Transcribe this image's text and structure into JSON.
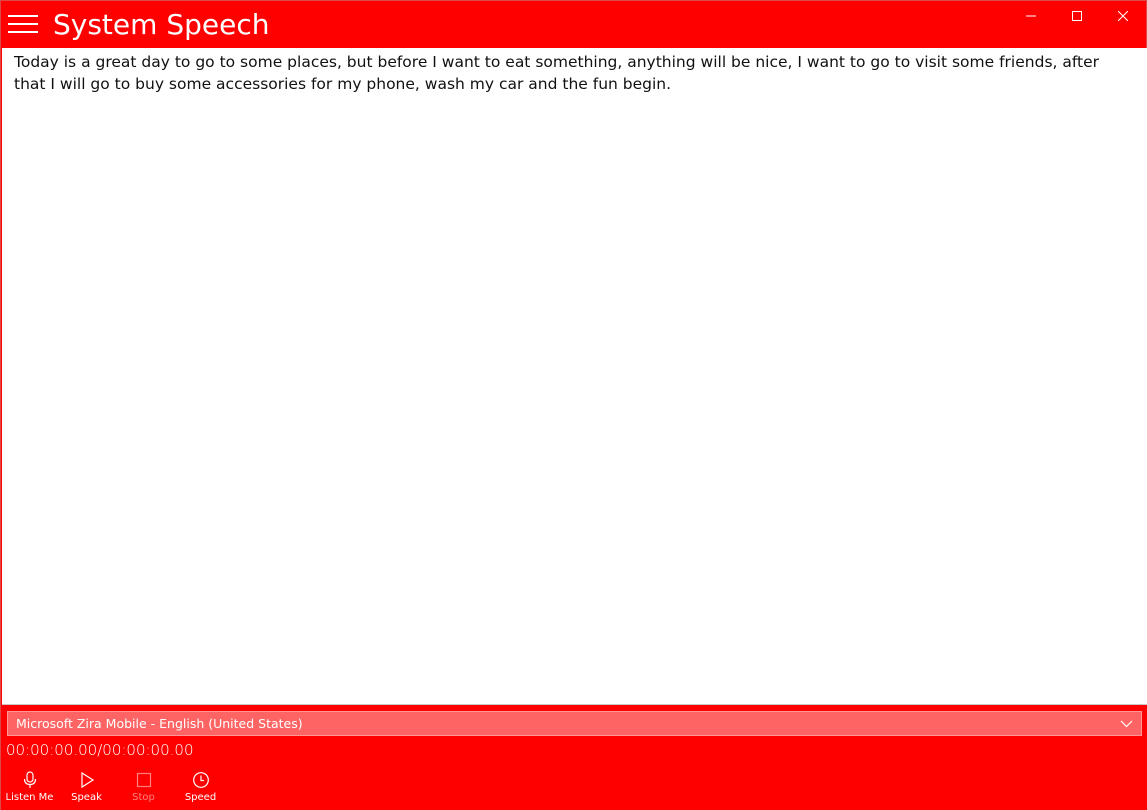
{
  "window": {
    "title": "System Speech",
    "accent_color": "#ff0000"
  },
  "editor": {
    "text": "Today is a great day to go to some places, but before I want to eat something, anything will be nice, I want to go to visit some friends, after that I will go to buy some accessories for my phone, wash my car and the fun begin."
  },
  "voice": {
    "selected": "Microsoft Zira Mobile - English (United States)"
  },
  "playback": {
    "timecode": "00:00:00.00/00:00:00.00"
  },
  "appbar": {
    "listen_label": "Listen Me",
    "speak_label": "Speak",
    "stop_label": "Stop",
    "speed_label": "Speed"
  }
}
